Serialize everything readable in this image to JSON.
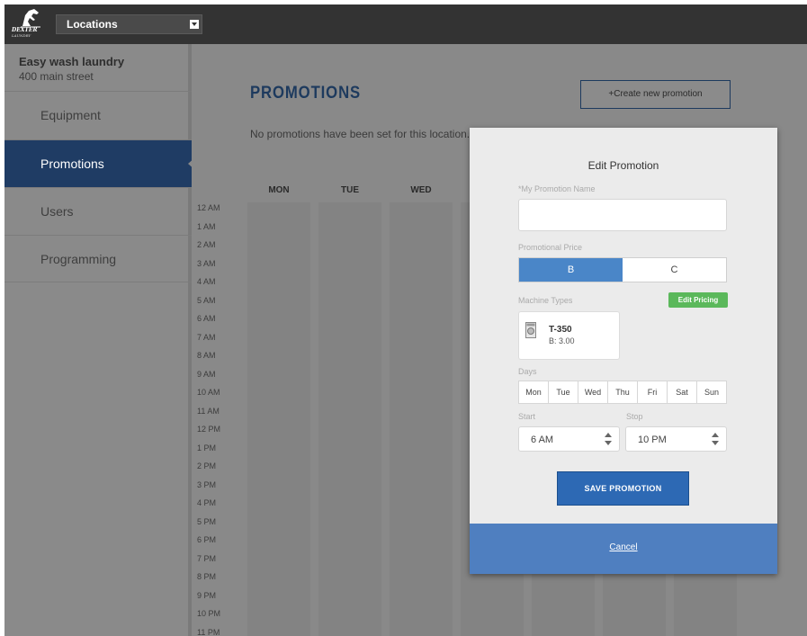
{
  "header": {
    "brand": "DEXTER",
    "brand_sub": "LAUNDRY",
    "location_select": "Locations"
  },
  "sidebar": {
    "location_name": "Easy wash laundry",
    "location_address": "400 main street",
    "items": [
      {
        "label": "Equipment"
      },
      {
        "label": "Promotions"
      },
      {
        "label": "Users"
      },
      {
        "label": "Programming"
      }
    ]
  },
  "main": {
    "title": "PROMOTIONS",
    "create_button": "Create new promotion",
    "empty_message": "No promotions have been set for this location.",
    "day_headers": [
      "MON",
      "TUE",
      "WED"
    ],
    "hours": [
      "12 AM",
      "1 AM",
      "2 AM",
      "3 AM",
      "4 AM",
      "5 AM",
      "6 AM",
      "7 AM",
      "8 AM",
      "9 AM",
      "10 AM",
      "11 AM",
      "12 PM",
      "1 PM",
      "2 PM",
      "3 PM",
      "4 PM",
      "5 PM",
      "6 PM",
      "7 PM",
      "8 PM",
      "9 PM",
      "10 PM",
      "11 PM"
    ]
  },
  "modal": {
    "title": "Edit Promotion",
    "name_label": "*My Promotion Name",
    "name_value": "",
    "price_label": "Promotional Price",
    "price_options": [
      "B",
      "C"
    ],
    "price_selected": "B",
    "machine_types_label": "Machine Types",
    "edit_pricing": "Edit Pricing",
    "machine": {
      "name": "T-350",
      "price": "B: 3.00"
    },
    "days_label": "Days",
    "days": [
      "Mon",
      "Tue",
      "Wed",
      "Thu",
      "Fri",
      "Sat",
      "Sun"
    ],
    "start_label": "Start",
    "start_value": "6 AM",
    "stop_label": "Stop",
    "stop_value": "10 PM",
    "save_button": "SAVE PROMOTION",
    "cancel": "Cancel"
  },
  "colors": {
    "topbar": "#333333",
    "nav_active": "#1f3c64",
    "title": "#1d3a5e",
    "toggle_active": "#4a86c8",
    "edit_pricing": "#5bb85b",
    "save_button": "#2d69b4",
    "modal_footer": "#4f7fc0"
  }
}
